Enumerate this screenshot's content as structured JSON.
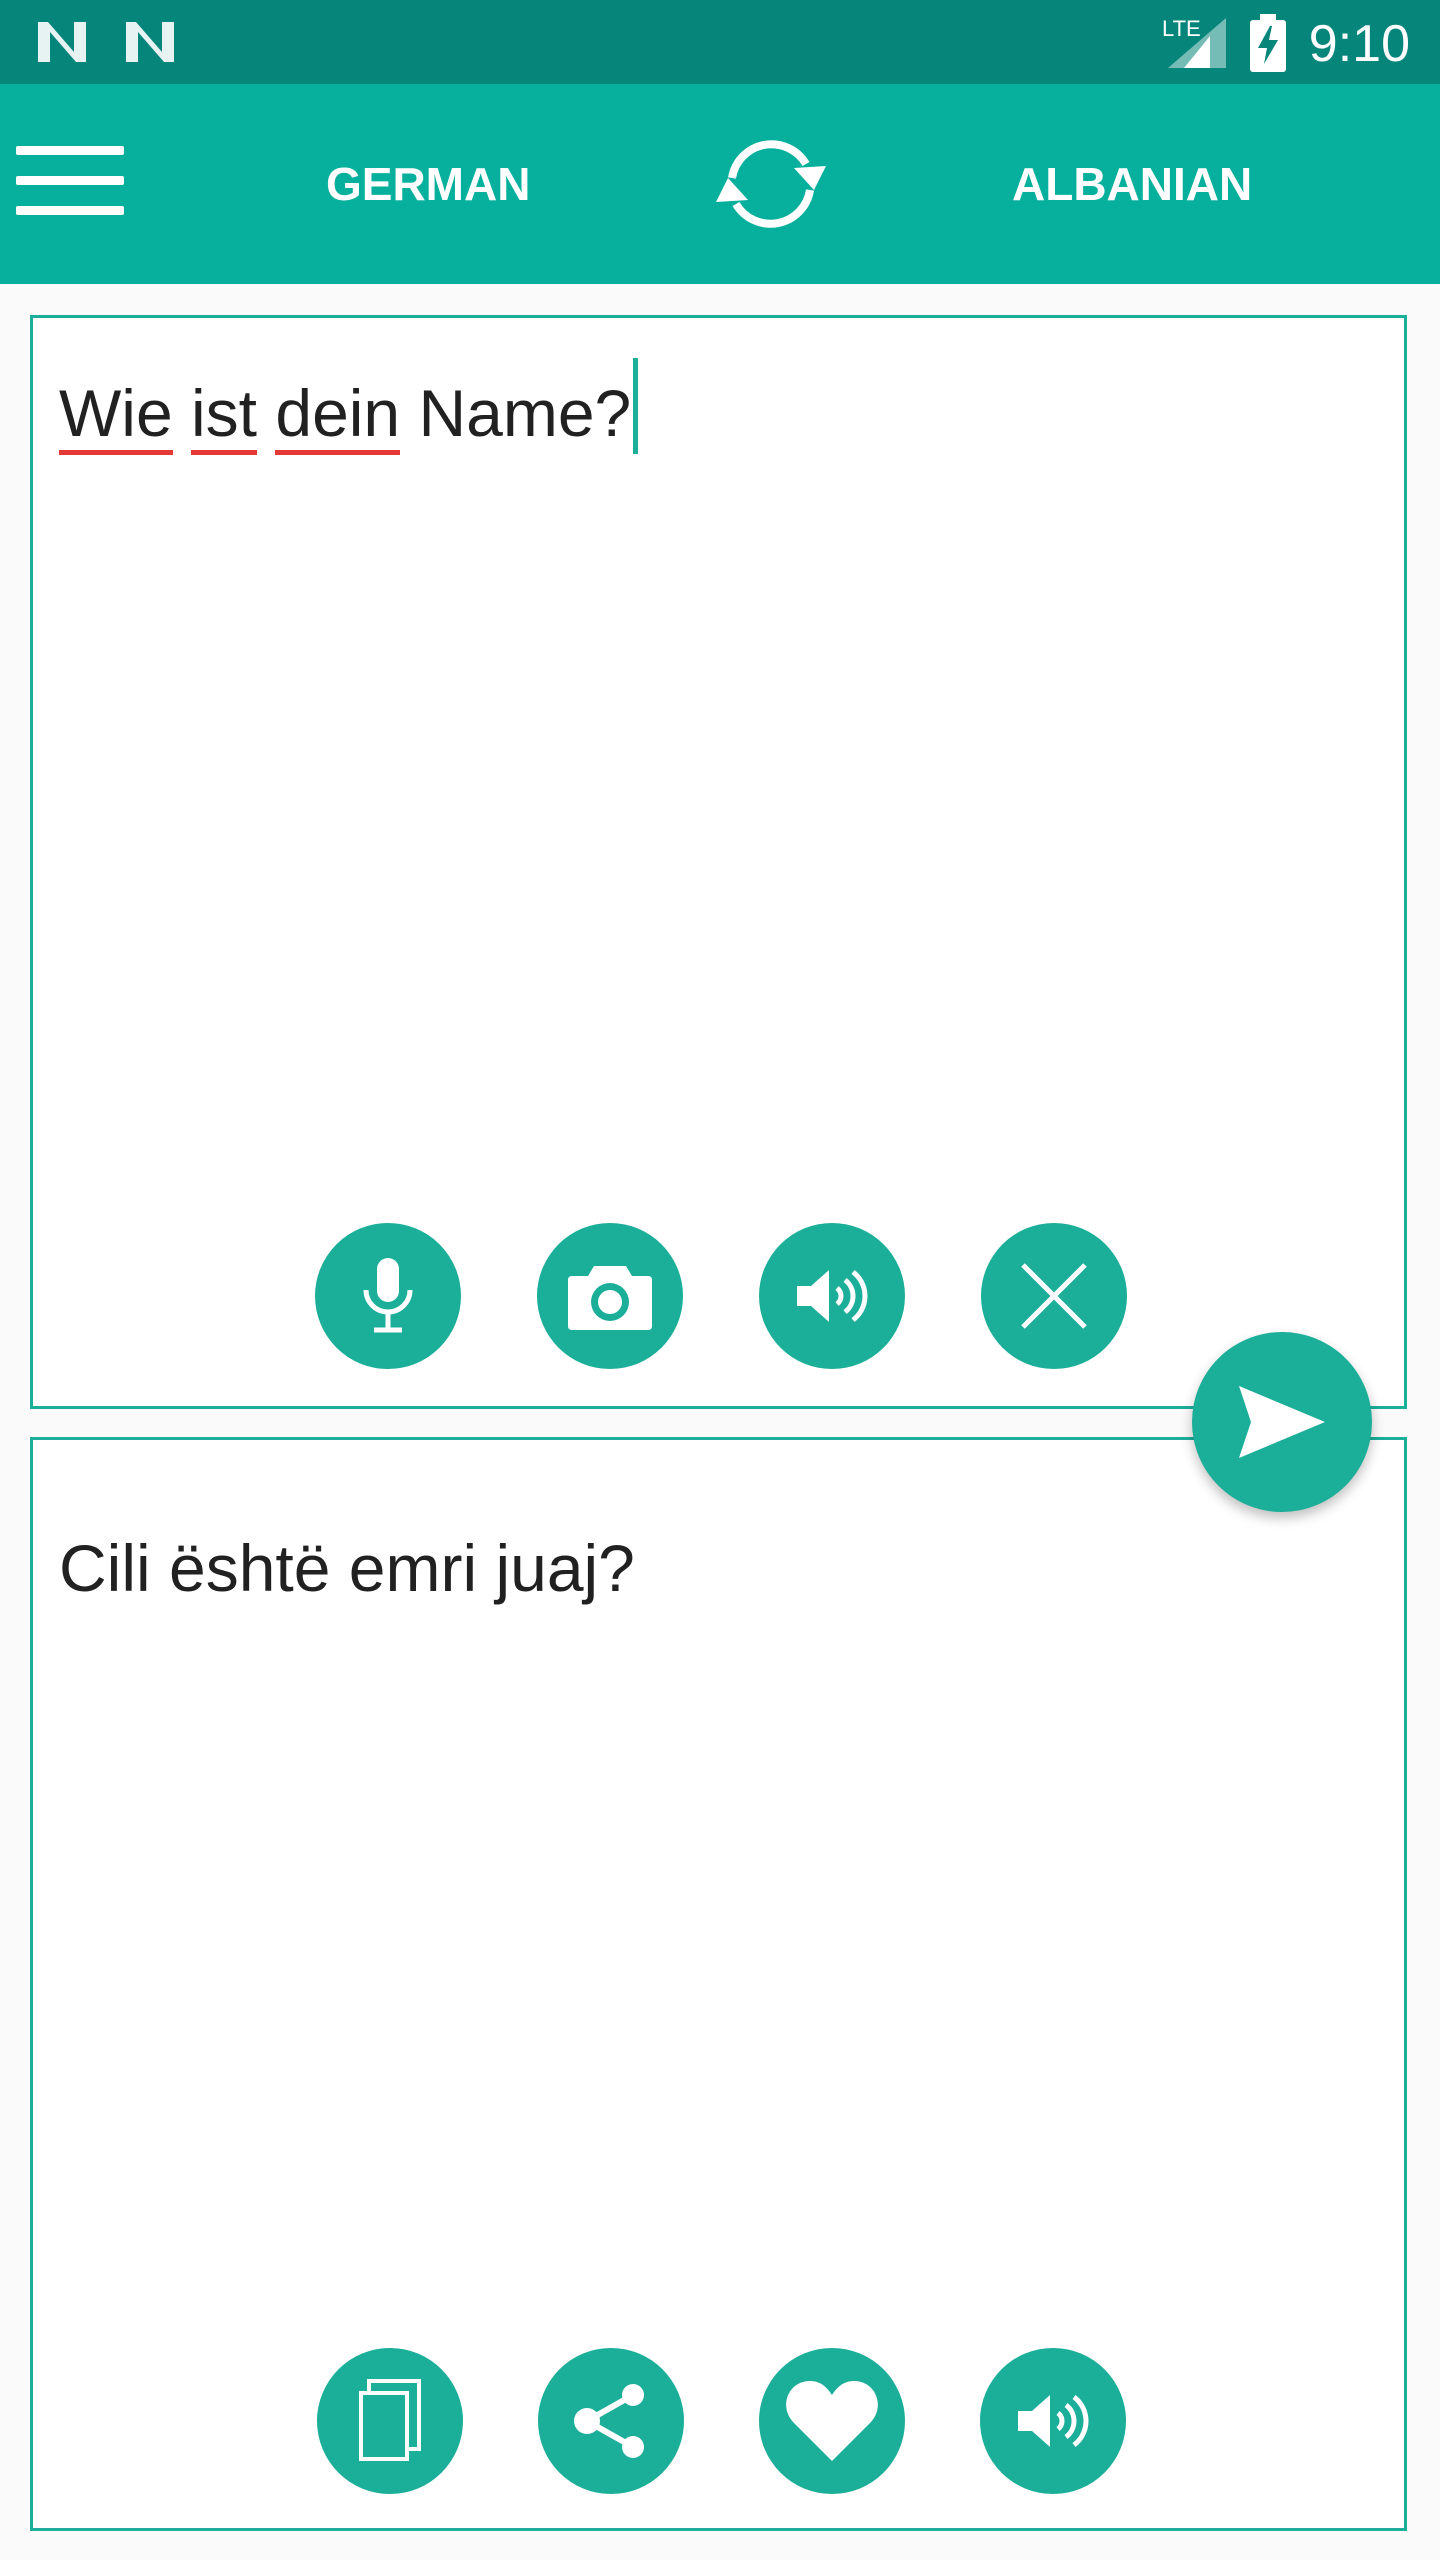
{
  "status_bar": {
    "time": "9:10",
    "network_label": "LTE",
    "icons": [
      "n-notification-icon",
      "n-notification-icon",
      "lte-signal-icon",
      "battery-charging-icon"
    ]
  },
  "toolbar": {
    "menu_icon": "menu-icon",
    "source_language": "GERMAN",
    "swap_icon": "swap-languages-icon",
    "target_language": "ALBANIAN"
  },
  "source_panel": {
    "words": [
      "Wie",
      "ist",
      "dein",
      "Name?"
    ],
    "actions": [
      "microphone-icon",
      "camera-icon",
      "speaker-icon",
      "clear-icon"
    ]
  },
  "target_panel": {
    "text": "Cili është emri juaj?",
    "actions": [
      "copy-icon",
      "share-icon",
      "favorite-icon",
      "speaker-icon"
    ]
  },
  "translate_button": {
    "icon": "send-icon"
  },
  "colors": {
    "status_bar": "#06857A",
    "toolbar": "#07B09C",
    "accent": "#1BAE99",
    "spellcheck": "#E53935",
    "text": "#212121"
  }
}
